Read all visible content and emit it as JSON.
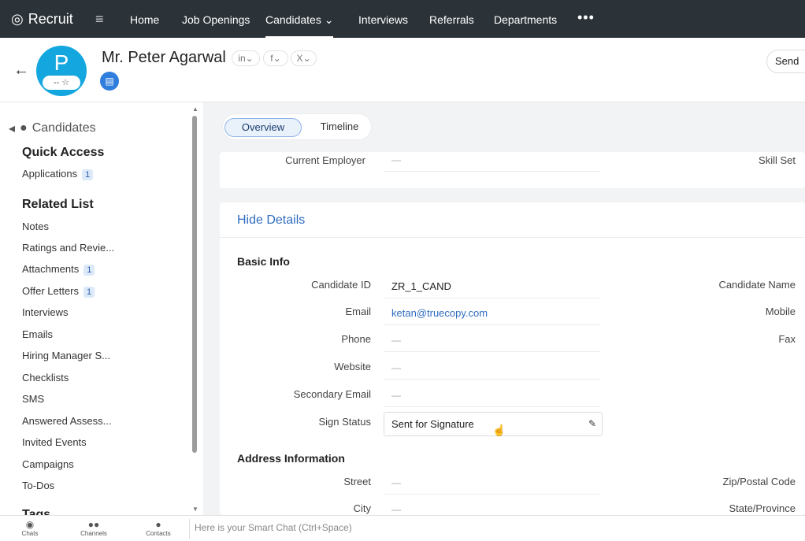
{
  "topnav": {
    "app_name": "Recruit",
    "menu_icon": "hamburger-icon",
    "items": [
      "Home",
      "Job Openings",
      "Candidates",
      "Interviews",
      "Referrals",
      "Departments"
    ],
    "active": "Candidates",
    "more": "•••"
  },
  "header": {
    "back_icon": "arrow-left-icon",
    "avatar_letter": "P",
    "rating": "-- ☆",
    "candidate_name": "Mr. Peter Agarwal",
    "social": [
      "in",
      "f",
      "X"
    ],
    "send_label": "Send"
  },
  "sidebar": {
    "title": "Candidates",
    "quick_access_title": "Quick Access",
    "quick_access_items": [
      {
        "label": "Applications",
        "count": "1"
      }
    ],
    "related_title": "Related List",
    "related_items": [
      {
        "label": "Notes",
        "count": ""
      },
      {
        "label": "Ratings and Revie...",
        "count": ""
      },
      {
        "label": "Attachments",
        "count": "1"
      },
      {
        "label": "Offer Letters",
        "count": "1"
      },
      {
        "label": "Interviews",
        "count": ""
      },
      {
        "label": "Emails",
        "count": ""
      },
      {
        "label": "Hiring Manager S...",
        "count": ""
      },
      {
        "label": "Checklists",
        "count": ""
      },
      {
        "label": "SMS",
        "count": ""
      },
      {
        "label": "Answered Assess...",
        "count": ""
      },
      {
        "label": "Invited Events",
        "count": ""
      },
      {
        "label": "Campaigns",
        "count": ""
      },
      {
        "label": "To-Dos",
        "count": ""
      }
    ],
    "tags_label": "Tags"
  },
  "main": {
    "tabs": [
      "Overview",
      "Timeline"
    ],
    "top_card": {
      "label": "Current Employer",
      "value": "—",
      "right_label": "Skill Set"
    },
    "hide_details": "Hide Details",
    "basic_info": "Basic Info",
    "fields": {
      "candidate_id": {
        "label": "Candidate ID",
        "value": "ZR_1_CAND"
      },
      "email": {
        "label": "Email",
        "value": "ketan@truecopy.com"
      },
      "phone": {
        "label": "Phone",
        "value": "—"
      },
      "website": {
        "label": "Website",
        "value": "—"
      },
      "secondary_email": {
        "label": "Secondary Email",
        "value": "—"
      },
      "sign_status": {
        "label": "Sign Status",
        "value": "Sent for Signature"
      }
    },
    "right_labels": [
      "Candidate Name",
      "Mobile",
      "Fax"
    ],
    "address_info": "Address Information",
    "address_fields": {
      "street": {
        "label": "Street",
        "value": "—"
      },
      "city": {
        "label": "City",
        "value": "—"
      }
    },
    "address_right_labels": [
      "Zip/Postal Code",
      "State/Province"
    ]
  },
  "bottombar": {
    "items": [
      "Chats",
      "Channels",
      "Contacts"
    ],
    "smart_chat": "Here is your Smart Chat (Ctrl+Space)"
  }
}
